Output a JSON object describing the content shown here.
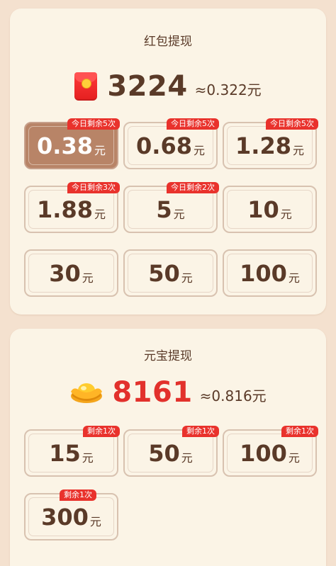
{
  "redpacket": {
    "title": "红包提现",
    "icon": "red-packet-icon",
    "balance": "3224",
    "approx": "≈0.322元",
    "options": [
      {
        "value": "0.38",
        "unit": "元",
        "badge": "今日剩余5次",
        "selected": true
      },
      {
        "value": "0.68",
        "unit": "元",
        "badge": "今日剩余5次"
      },
      {
        "value": "1.28",
        "unit": "元",
        "badge": "今日剩余5次"
      },
      {
        "value": "1.88",
        "unit": "元",
        "badge": "今日剩余3次"
      },
      {
        "value": "5",
        "unit": "元",
        "badge": "今日剩余2次"
      },
      {
        "value": "10",
        "unit": "元"
      },
      {
        "value": "30",
        "unit": "元"
      },
      {
        "value": "50",
        "unit": "元"
      },
      {
        "value": "100",
        "unit": "元"
      }
    ]
  },
  "ingot": {
    "title": "元宝提现",
    "icon": "gold-ingot-icon",
    "balance": "8161",
    "approx": "≈0.816元",
    "options": [
      {
        "value": "15",
        "unit": "元",
        "badge": "剩余1次"
      },
      {
        "value": "50",
        "unit": "元",
        "badge": "剩余1次"
      },
      {
        "value": "100",
        "unit": "元",
        "badge": "剩余1次"
      },
      {
        "value": "300",
        "unit": "元",
        "badge": "剩余1次"
      }
    ]
  },
  "colors": {
    "page_bg": "#f4e1cf",
    "card_bg": "#fbf4e6",
    "text_brown": "#5a3a28",
    "ingot_balance_red": "#e2312c",
    "badge_red": "#e9322c",
    "selected_bg": "#b88467"
  }
}
